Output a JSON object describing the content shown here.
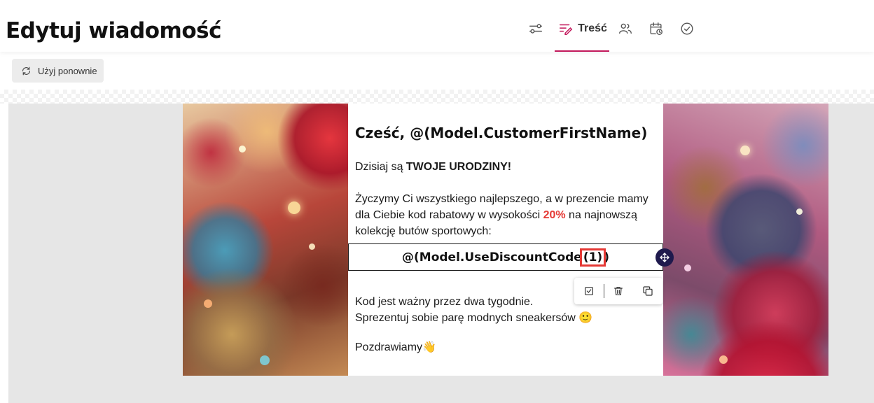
{
  "header": {
    "title": "Edytuj wiadomość",
    "steps": [
      {
        "icon": "sliders-icon"
      },
      {
        "icon": "content-edit-icon",
        "label": "Treść",
        "active": true
      },
      {
        "icon": "users-icon"
      },
      {
        "icon": "calendar-clock-icon"
      },
      {
        "icon": "check-circle-icon"
      }
    ],
    "accent_color": "#c2185b"
  },
  "toolbar": {
    "reuse_label": "Użyj ponownie"
  },
  "email": {
    "greeting": "Cześć, @(Model.CustomerFirstName)",
    "line1_prefix": "Dzisiaj są ",
    "line1_bold": "TWOJE URODZINY!",
    "para2_part1": "Życzymy Ci wszystkiego najlepszego, a w prezencie mamy dla Ciebie kod rabatowy w wysokości ",
    "discount": "20%",
    "para2_part2": " na najnowszą kolekcję butów sportowych:",
    "code_main": "@(Model.UseDiscountCode",
    "code_highlight": "(1)",
    "code_end": ")",
    "validity": "Kod jest ważny przez dwa tygodnie.",
    "suggestion": "Sprezentuj sobie parę modnych sneakersów 🙂",
    "closing": "Pozdrawiamy👋"
  },
  "block_toolbar": {
    "icons": [
      "checkbox-icon",
      "trash-icon",
      "duplicate-icon"
    ]
  },
  "colors": {
    "discount": "#e53935",
    "highlight_border": "#e53935",
    "move_handle": "#1f1a4d",
    "canvas_bg": "#e6e6e6"
  }
}
